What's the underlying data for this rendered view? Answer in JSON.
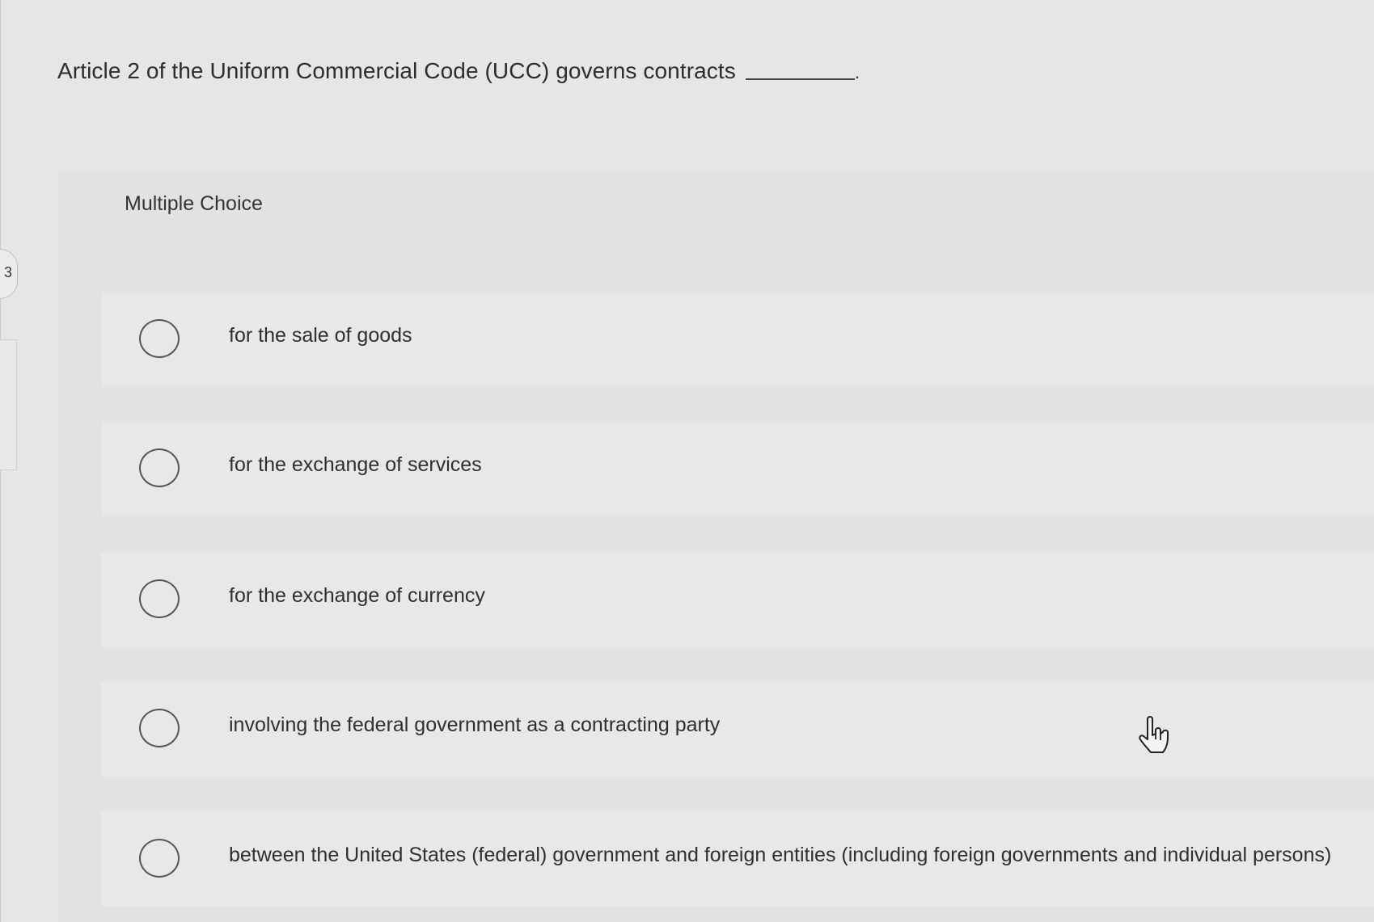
{
  "question": {
    "text": "Article 2 of the Uniform Commercial Code (UCC) governs contracts",
    "period": "."
  },
  "choice_block": {
    "label": "Multiple Choice",
    "options": [
      {
        "text": "for the sale of goods"
      },
      {
        "text": "for the exchange of services"
      },
      {
        "text": "for the exchange of currency"
      },
      {
        "text": "involving the federal government as a contracting party"
      },
      {
        "text": "between the United States (federal) government and foreign entities (including foreign governments and individual persons)"
      }
    ]
  },
  "side_tab": {
    "label": "3"
  },
  "icons": {
    "pointer": "hand-pointer-icon"
  }
}
